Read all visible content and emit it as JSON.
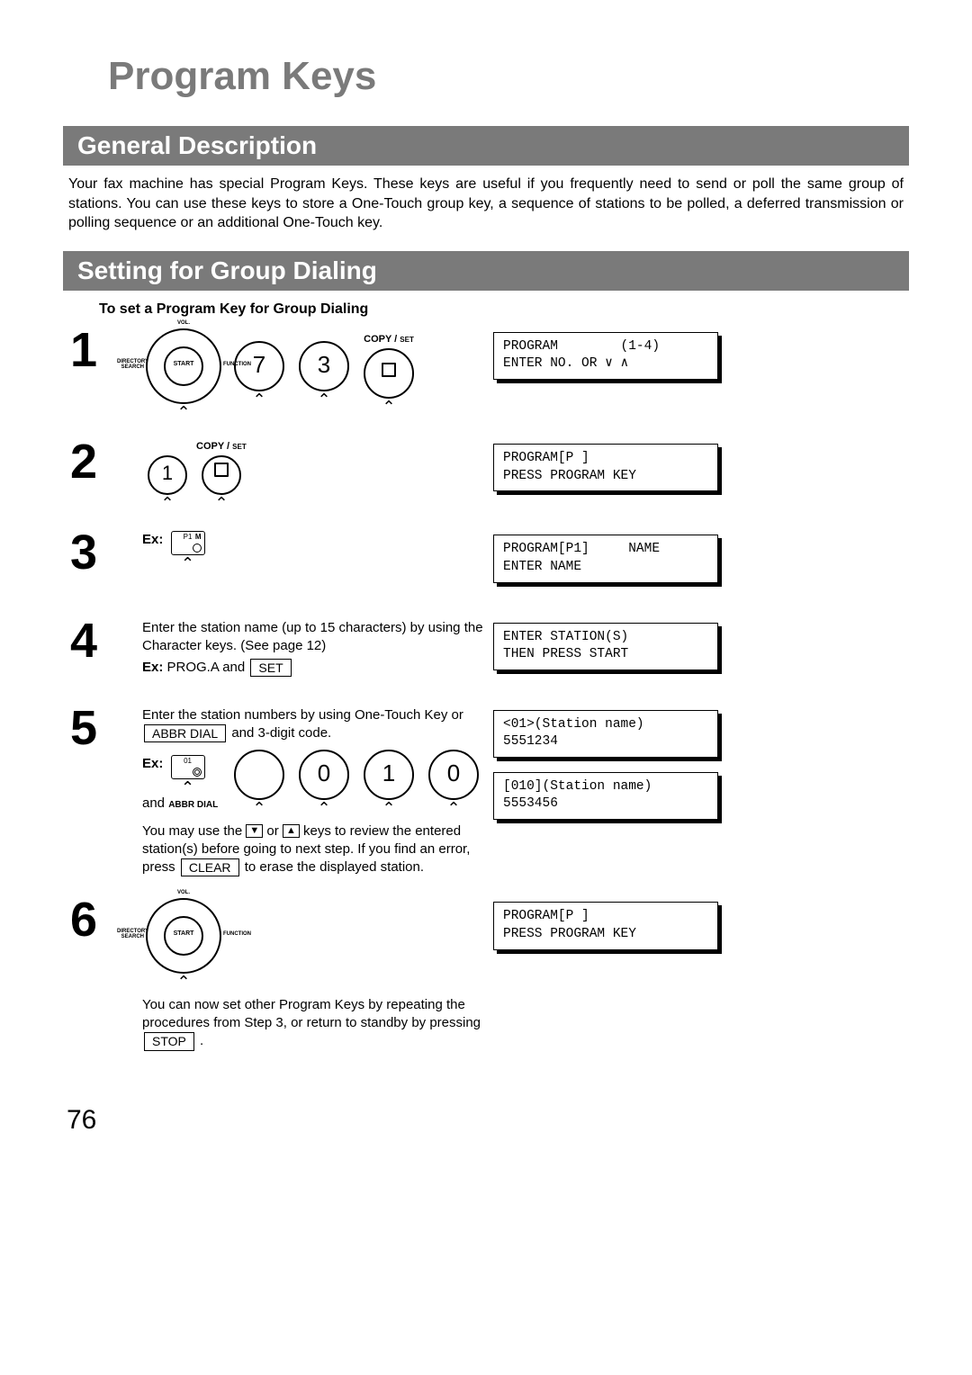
{
  "title": "Program Keys",
  "section_general_header": "General Description",
  "section_general_body": "Your fax machine has special Program Keys.  These keys are useful if you frequently need to send or poll the same group of stations.  You can use these keys to store a One-Touch group key, a sequence of stations to be polled, a deferred transmission or polling sequence or an additional One-Touch key.",
  "section_group_header": "Setting for Group Dialing",
  "subhead": "To set a Program Key for Group Dialing",
  "copy_set": "COPY /",
  "copy_set_small": "SET",
  "nav": {
    "vol": "VOL.",
    "start": "START",
    "dir": "DIRECTORY\nSEARCH",
    "func": "FUNCTION"
  },
  "keys": {
    "seven": "7",
    "three": "3",
    "one": "1",
    "zero": "0",
    "p1": "P1",
    "m": "M",
    "o01": "01"
  },
  "abbr_dial": "ABBR DIAL",
  "clear": "CLEAR",
  "set_btn": "SET",
  "stop": "STOP",
  "steps": {
    "1": {
      "num": "1"
    },
    "2": {
      "num": "2"
    },
    "3": {
      "num": "3",
      "ex": "Ex:"
    },
    "4": {
      "num": "4",
      "text": "Enter the station name (up to 15 characters) by using the Character keys.  (See page 12)",
      "ex_line_prefix": "Ex:",
      "ex_line": " PROG.A and "
    },
    "5": {
      "num": "5",
      "text_a": "Enter the station numbers by using One-Touch Key or ",
      "text_b": " and 3-digit code.",
      "ex": "Ex:",
      "and": "and",
      "review_a": "You may use the ",
      "review_b": " or ",
      "review_c": " keys to review the entered station(s) before going to next step. If you find an error, press ",
      "review_d": " to erase the displayed station."
    },
    "6": {
      "num": "6",
      "text": "You can now set other Program Keys by repeating the procedures from Step 3, or return to standby by pressing "
    }
  },
  "lcd": {
    "1": "PROGRAM        (1-4)\nENTER NO. OR ∨ ∧",
    "2": "PROGRAM[P ]\nPRESS PROGRAM KEY",
    "3": "PROGRAM[P1]     NAME\nENTER NAME",
    "4": "ENTER STATION(S)\nTHEN PRESS START",
    "5a": "<01>(Station name)\n5551234",
    "5b": "[010](Station name)\n5553456",
    "6": "PROGRAM[P ]\nPRESS PROGRAM KEY"
  },
  "page_number": "76"
}
